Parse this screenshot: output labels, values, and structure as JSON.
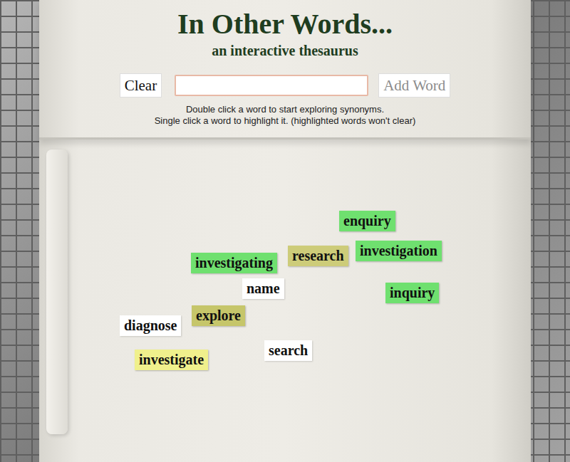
{
  "header": {
    "title": "In Other Words...",
    "subtitle": "an interactive thesaurus"
  },
  "controls": {
    "clear_button": "Clear",
    "input": {
      "value": ""
    },
    "add_button": "Add Word"
  },
  "help": [
    "Double click a word to start exploring synonyms.",
    "Single click a word to highlight it. (highlighted words won't clear)"
  ],
  "words": [
    {
      "text": "enquiry",
      "highlighted": true,
      "color": "#6fe06f"
    },
    {
      "text": "investigation",
      "highlighted": true,
      "color": "#6fe06f"
    },
    {
      "text": "research",
      "highlighted": true,
      "color": "#cdcc79"
    },
    {
      "text": "investigating",
      "highlighted": true,
      "color": "#6fe06f"
    },
    {
      "text": "inquiry",
      "highlighted": true,
      "color": "#6fe06f"
    },
    {
      "text": "name",
      "highlighted": false,
      "color": "#ffffff"
    },
    {
      "text": "explore",
      "highlighted": true,
      "color": "#c6c66a"
    },
    {
      "text": "diagnose",
      "highlighted": false,
      "color": "#ffffff"
    },
    {
      "text": "search",
      "highlighted": false,
      "color": "#ffffff"
    },
    {
      "text": "investigate",
      "highlighted": true,
      "color": "#f0f08c"
    }
  ]
}
